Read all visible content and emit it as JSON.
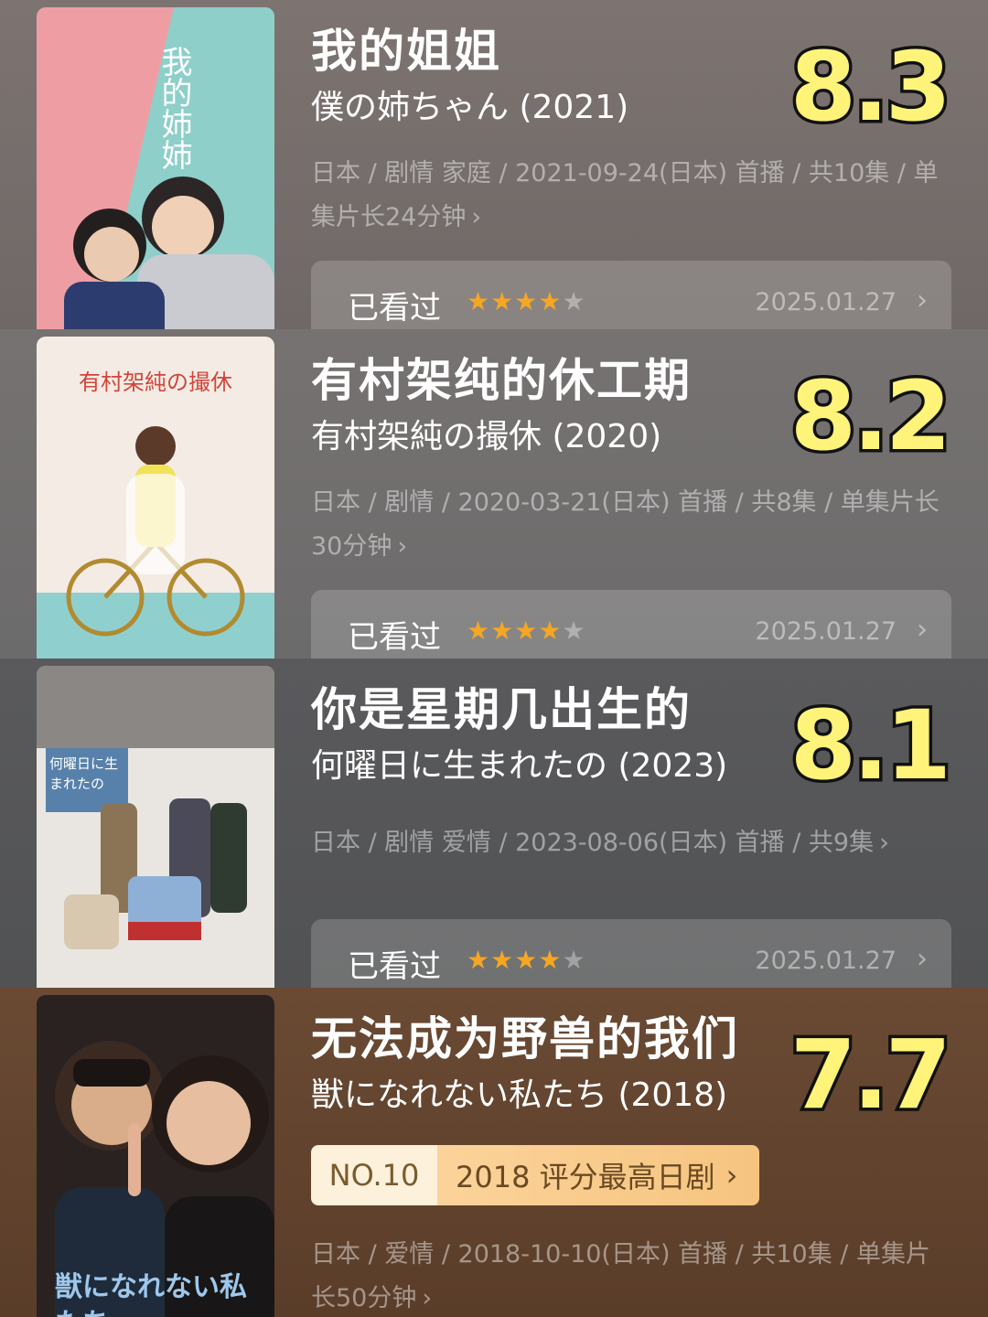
{
  "colors": {
    "rating_fill": "#fff37a",
    "rating_stroke": "#111111",
    "star": "#f5a623"
  },
  "cards": [
    {
      "title": "我的姐姐",
      "subtitle": "僕の姉ちゃん (2021)",
      "rating": "8.3",
      "meta": "日本 / 剧情 家庭 / 2021-09-24(日本) 首播 / 共10集 / 单集片长24分钟",
      "meta_chevron": "›",
      "watched": {
        "label": "已看过",
        "stars": 4,
        "stars_max": 5,
        "date": "2025.01.27",
        "chevron": "›"
      },
      "poster": {
        "title_text": "我的姉姉"
      }
    },
    {
      "title": "有村架纯的休工期",
      "subtitle": "有村架純の撮休 (2020)",
      "rating": "8.2",
      "meta": "日本 / 剧情 / 2020-03-21(日本) 首播 / 共8集 / 单集片长30分钟",
      "meta_chevron": "›",
      "watched": {
        "label": "已看过",
        "stars": 4,
        "stars_max": 5,
        "date": "2025.01.27",
        "chevron": "›"
      },
      "poster": {
        "title_text": "有村架純の撮休"
      }
    },
    {
      "title": "你是星期几出生的",
      "subtitle": "何曜日に生まれたの (2023)",
      "rating": "8.1",
      "meta": "日本 / 剧情 爱情 / 2023-08-06(日本) 首播 / 共9集",
      "meta_chevron": "›",
      "watched": {
        "label": "已看过",
        "stars": 4,
        "stars_max": 5,
        "date": "2025.01.27",
        "chevron": "›"
      },
      "poster": {
        "title_text": "何曜日に生まれたの"
      }
    },
    {
      "title": "无法成为野兽的我们",
      "subtitle": "獣になれない私たち (2018)",
      "rating": "7.7",
      "rank": {
        "no": "NO.10",
        "text": "2018 评分最高日剧",
        "chevron": "›"
      },
      "meta": "日本 / 爱情 / 2018-10-10(日本) 首播 / 共10集 / 单集片长50分钟",
      "meta_chevron": "›",
      "poster": {
        "title_text": "獣になれない私たち"
      }
    }
  ]
}
